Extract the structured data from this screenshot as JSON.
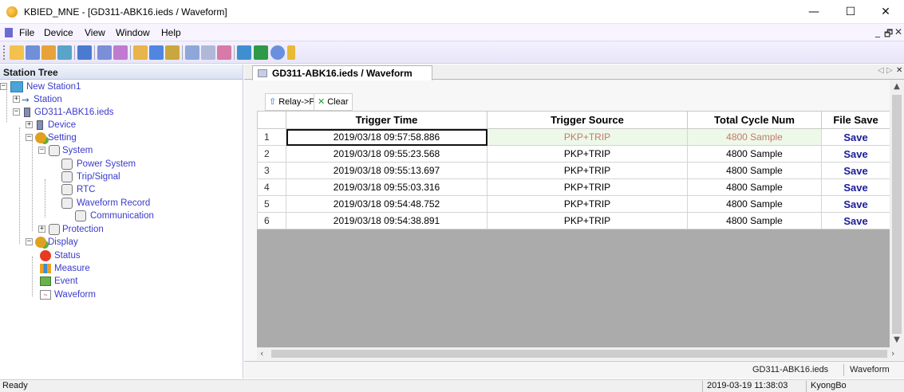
{
  "window": {
    "title": "KBIED_MNE - [GD311-ABK16.ieds / Waveform]",
    "minimize": "—",
    "maximize": "☐",
    "close": "✕"
  },
  "menu": {
    "items": [
      "File",
      "Device",
      "View",
      "Window",
      "Help"
    ],
    "mdi_min": "_",
    "mdi_restore": "🗗",
    "mdi_close": "✕"
  },
  "toolbar": {
    "icons": [
      "open-icon",
      "save-icon",
      "connect-icon",
      "network-icon",
      "tree-icon",
      "disconnect-icon",
      "print-icon",
      "settings-icon",
      "monitor-icon",
      "grid-icon",
      "window-icon",
      "wave-icon",
      "wave-edit-icon",
      "export-icon",
      "delete-icon",
      "help-icon",
      "dropdown-icon"
    ]
  },
  "tree": {
    "header": "Station Tree",
    "nodes": {
      "station_root": "New Station1",
      "station": "Station",
      "device_file": "GD311-ABK16.ieds",
      "device": "Device",
      "setting": "Setting",
      "system": "System",
      "power_system": "Power System",
      "trip_signal": "Trip/Signal",
      "rtc": "RTC",
      "waveform_record": "Waveform Record",
      "communication": "Communication",
      "protection": "Protection",
      "display": "Display",
      "status": "Status",
      "measure": "Measure",
      "event": "Event",
      "waveform": "Waveform"
    }
  },
  "document": {
    "tab_label": "GD311-ABK16.ieds / Waveform",
    "tab_prev": "◁",
    "tab_next": "▷",
    "tab_close": "✕",
    "actions": {
      "relay_to_pc": "Relay->PC",
      "clear": "Clear"
    },
    "grid": {
      "columns": [
        "",
        "Trigger Time",
        "Trigger Source",
        "Total Cycle Num",
        "File Save"
      ],
      "rows": [
        {
          "num": "1",
          "time": "2019/03/18 09:57:58.886",
          "source": "PKP+TRIP",
          "cycles": "4800 Sample",
          "save": "Save"
        },
        {
          "num": "2",
          "time": "2019/03/18 09:55:23.568",
          "source": "PKP+TRIP",
          "cycles": "4800 Sample",
          "save": "Save"
        },
        {
          "num": "3",
          "time": "2019/03/18 09:55:13.697",
          "source": "PKP+TRIP",
          "cycles": "4800 Sample",
          "save": "Save"
        },
        {
          "num": "4",
          "time": "2019/03/18 09:55:03.316",
          "source": "PKP+TRIP",
          "cycles": "4800 Sample",
          "save": "Save"
        },
        {
          "num": "5",
          "time": "2019/03/18 09:54:48.752",
          "source": "PKP+TRIP",
          "cycles": "4800 Sample",
          "save": "Save"
        },
        {
          "num": "6",
          "time": "2019/03/18 09:54:38.891",
          "source": "PKP+TRIP",
          "cycles": "4800 Sample",
          "save": "Save"
        }
      ]
    },
    "status": {
      "file": "GD311-ABK16.ieds",
      "view": "Waveform"
    }
  },
  "statusbar": {
    "state": "Ready",
    "datetime": "2019-03-19 11:38:03",
    "user": "KyongBo"
  }
}
